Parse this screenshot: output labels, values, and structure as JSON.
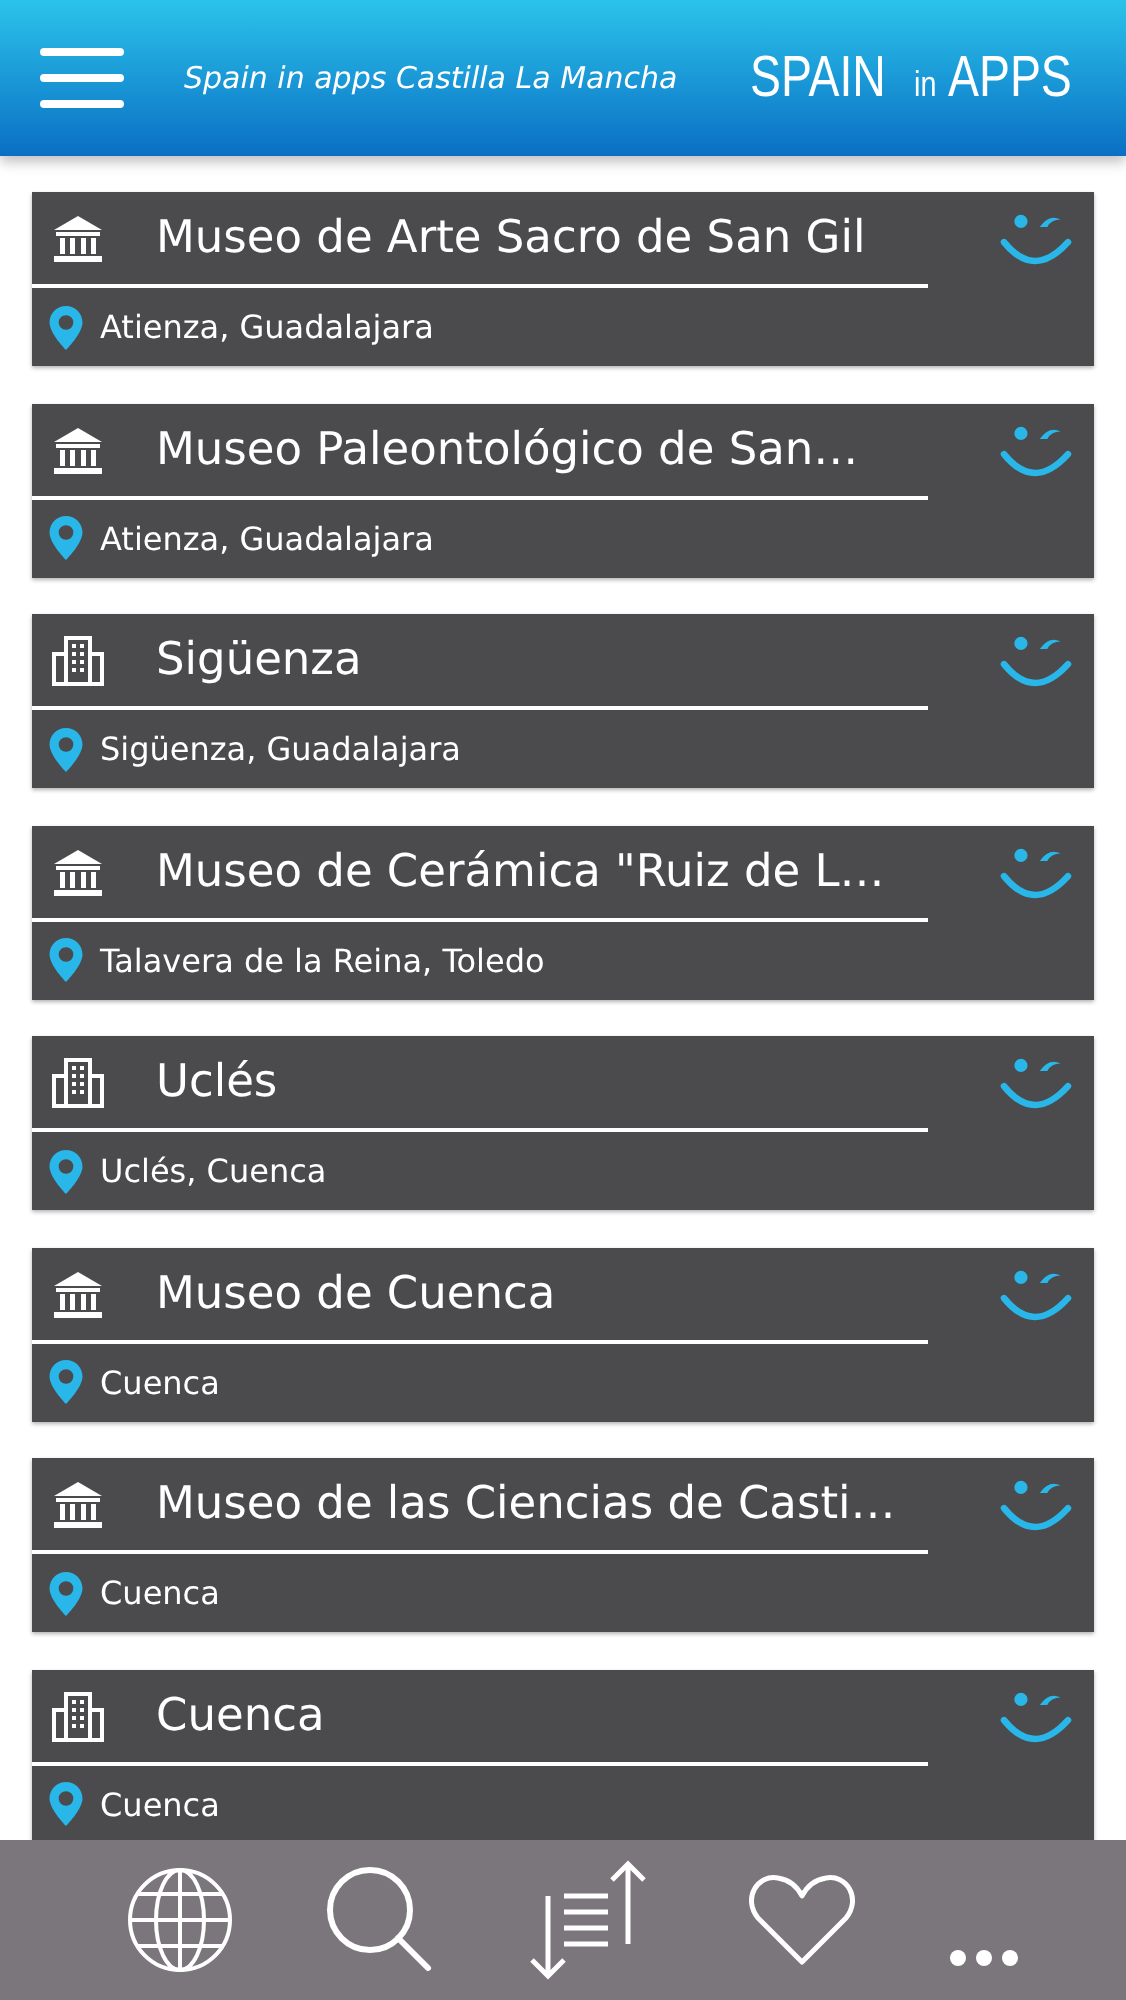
{
  "header": {
    "title": "Spain in apps Castilla La Mancha",
    "logo": [
      "SPAIN",
      "in",
      "APPS"
    ]
  },
  "places": [
    {
      "kind": "museum",
      "name": "Museo de Arte Sacro de San Gil",
      "location": "Atienza, Guadalajara"
    },
    {
      "kind": "museum",
      "name": "Museo Paleontológico de San…",
      "location": "Atienza, Guadalajara"
    },
    {
      "kind": "town",
      "name": "Sigüenza",
      "location": "Sigüenza, Guadalajara"
    },
    {
      "kind": "museum",
      "name": "Museo de Cerámica \"Ruiz de L…",
      "location": "Talavera de la Reina, Toledo"
    },
    {
      "kind": "town",
      "name": "Uclés",
      "location": "Uclés, Cuenca"
    },
    {
      "kind": "museum",
      "name": "Museo de Cuenca",
      "location": "Cuenca"
    },
    {
      "kind": "museum",
      "name": "Museo de las Ciencias de Casti…",
      "location": "Cuenca"
    },
    {
      "kind": "town",
      "name": "Cuenca",
      "location": "Cuenca"
    }
  ]
}
